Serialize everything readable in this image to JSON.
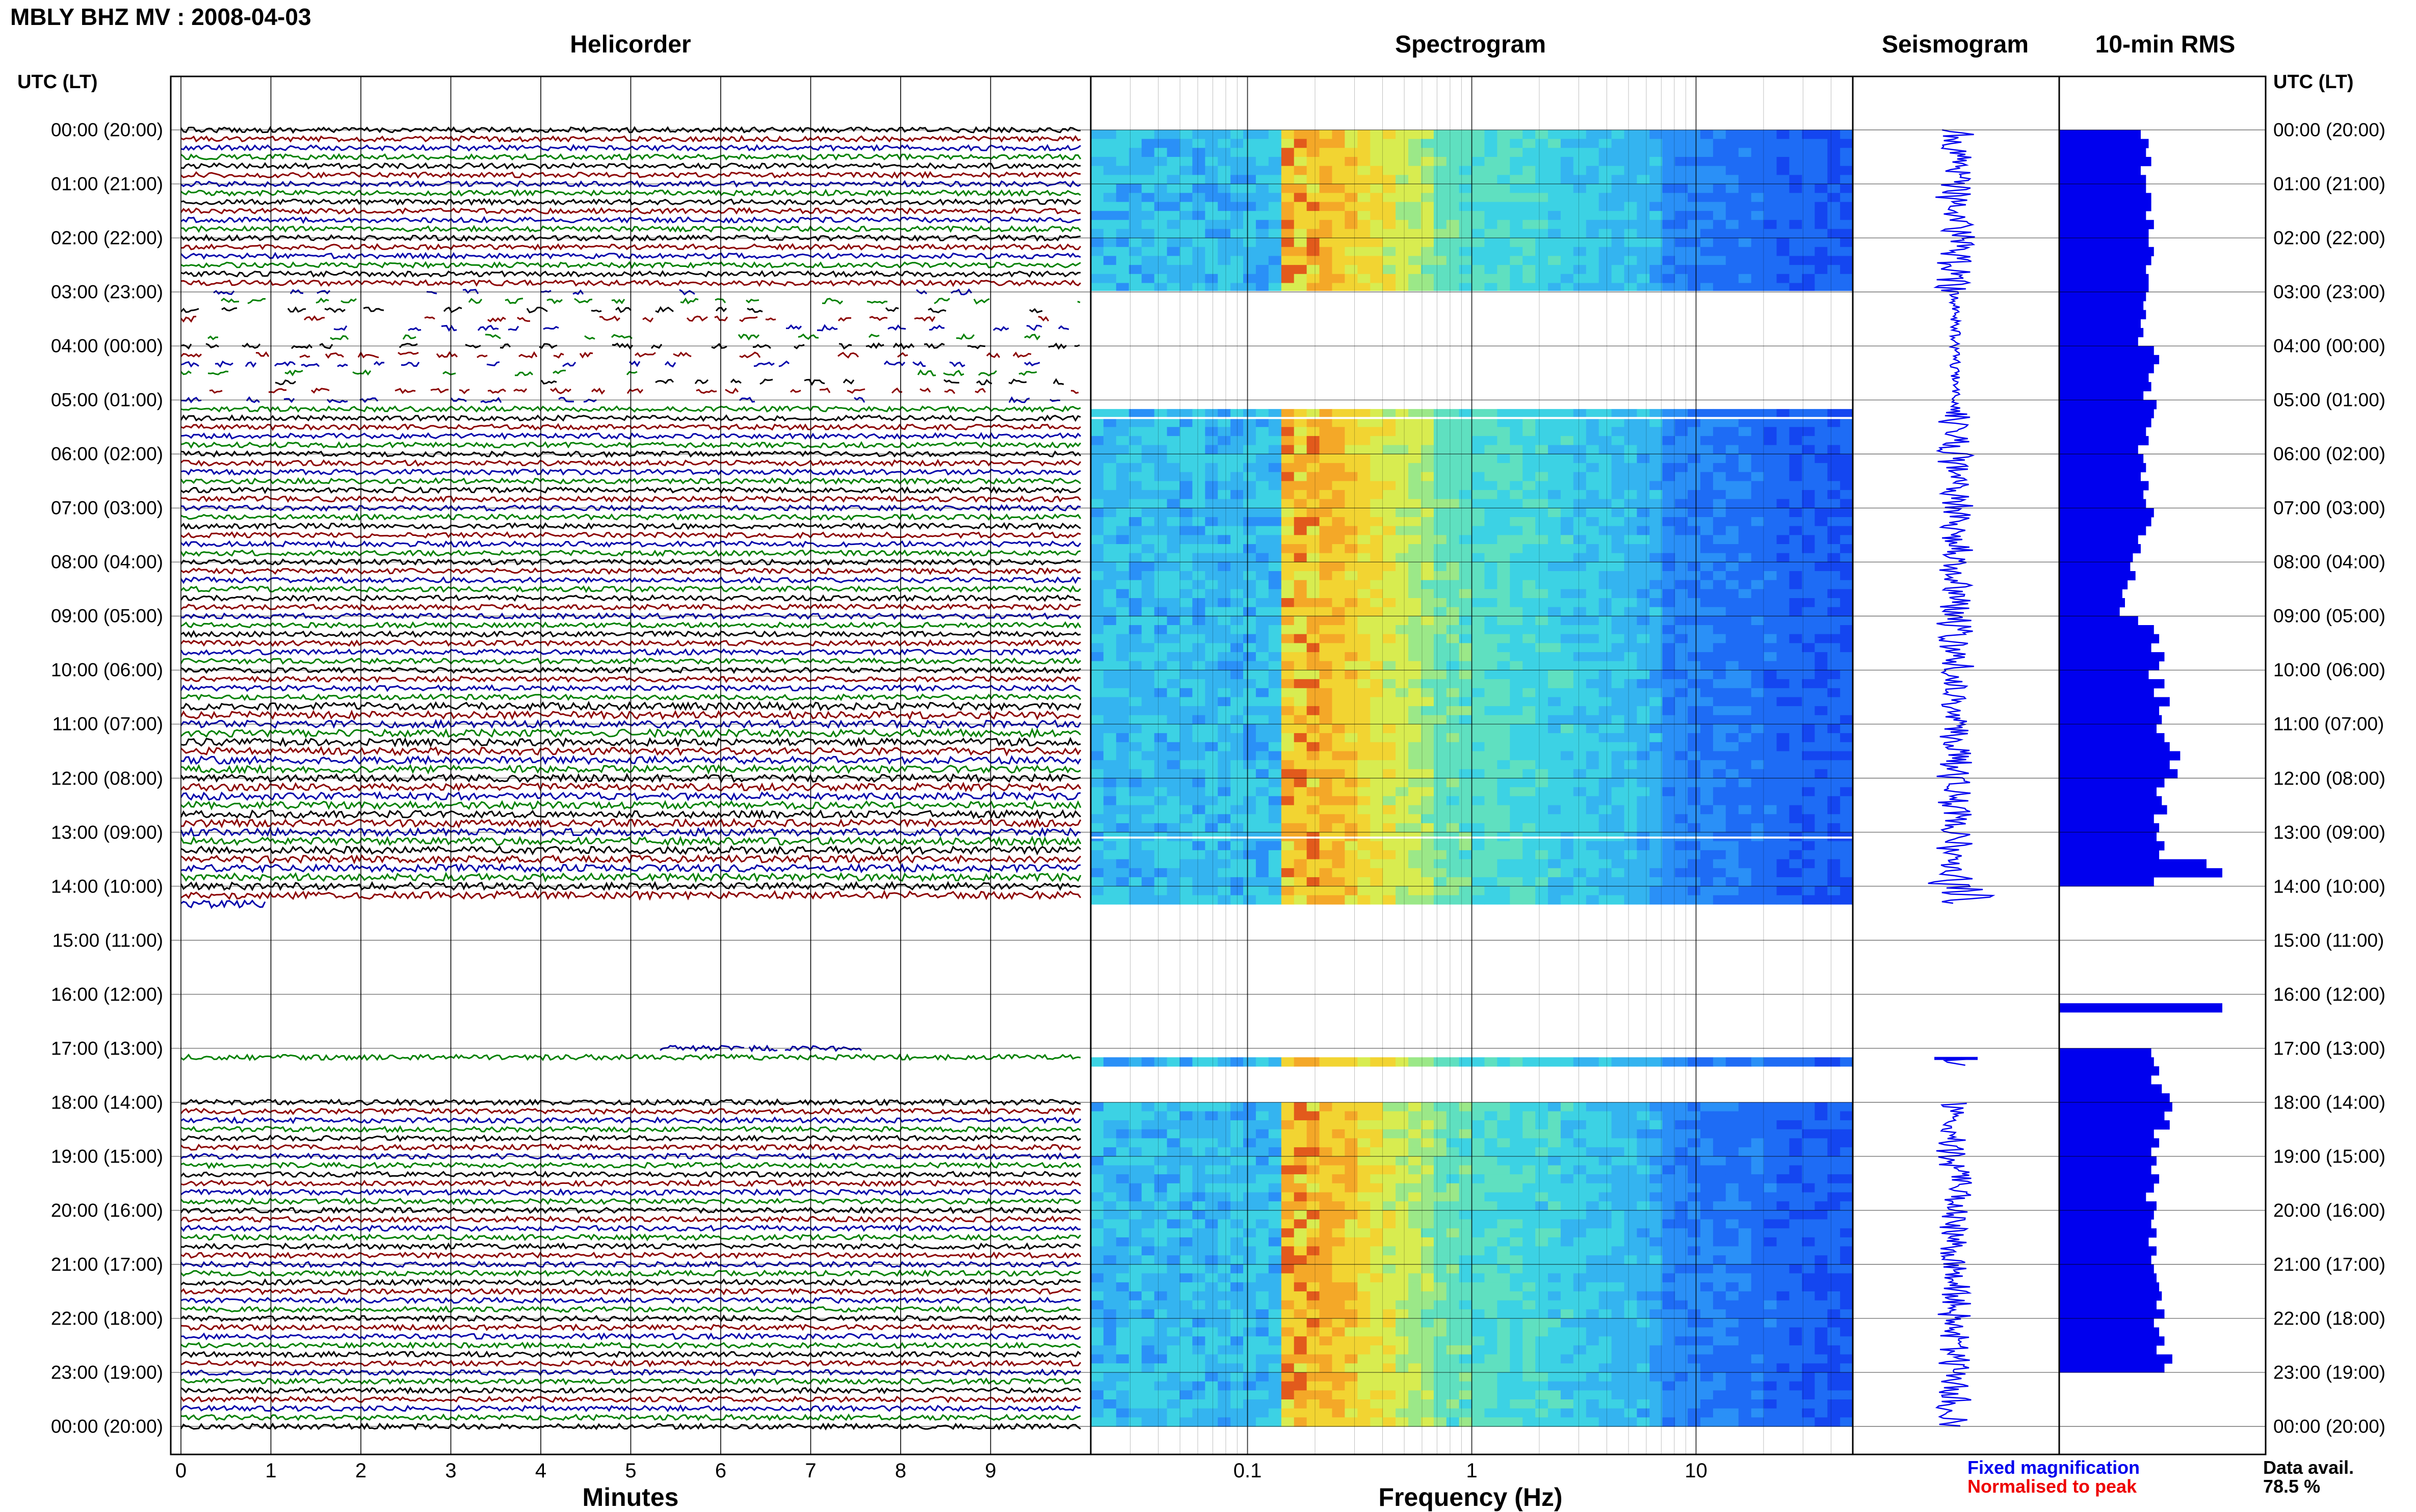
{
  "title": "MBLY BHZ MV : 2008-04-03",
  "panels": {
    "helicorder": "Helicorder",
    "spectrogram": "Spectrogram",
    "seismogram": "Seismogram",
    "rms": "10-min RMS"
  },
  "time_axis_label": "UTC (LT)",
  "time_labels": [
    "00:00 (20:00)",
    "01:00 (21:00)",
    "02:00 (22:00)",
    "03:00 (23:00)",
    "04:00 (00:00)",
    "05:00 (01:00)",
    "06:00 (02:00)",
    "07:00 (03:00)",
    "08:00 (04:00)",
    "09:00 (05:00)",
    "10:00 (06:00)",
    "11:00 (07:00)",
    "12:00 (08:00)",
    "13:00 (09:00)",
    "14:00 (10:00)",
    "15:00 (11:00)",
    "16:00 (12:00)",
    "17:00 (13:00)",
    "18:00 (14:00)",
    "19:00 (15:00)",
    "20:00 (16:00)",
    "21:00 (17:00)",
    "22:00 (18:00)",
    "23:00 (19:00)",
    "00:00 (20:00)"
  ],
  "helicorder_axis": {
    "label": "Minutes",
    "ticks": [
      "0",
      "1",
      "2",
      "3",
      "4",
      "5",
      "6",
      "7",
      "8",
      "9"
    ]
  },
  "spectrogram_axis": {
    "label": "Frequency (Hz)",
    "ticks": [
      "0.1",
      "1",
      "10"
    ]
  },
  "legend": {
    "fixed": "Fixed magnification",
    "normalised": "Normalised to peak",
    "fixed_color": "#0000ee",
    "normalised_color": "#ee0000"
  },
  "data_availability": {
    "label": "Data avail.",
    "value": "78.5 %"
  },
  "colors": {
    "trace_black": "#000000",
    "trace_red": "#8b0000",
    "trace_blue": "#0000aa",
    "trace_green": "#008000",
    "rms_bar": "#0000ee",
    "seis": "#0000ee"
  },
  "data_gaps_utc": [
    [
      "03:00",
      "05:10"
    ],
    [
      "14:20",
      "17:10"
    ],
    [
      "17:20",
      "18:00"
    ]
  ],
  "rms_10min": [
    0.62,
    0.68,
    0.66,
    0.7,
    0.62,
    0.66,
    0.66,
    0.7,
    0.7,
    0.66,
    0.72,
    0.68,
    0.68,
    0.72,
    0.7,
    0.66,
    0.68,
    0.68,
    0.66,
    0.64,
    0.66,
    0.62,
    0.64,
    0.6,
    0.72,
    0.76,
    0.72,
    0.68,
    0.7,
    0.64,
    0.74,
    0.72,
    0.7,
    0.66,
    0.68,
    0.6,
    0.64,
    0.66,
    0.62,
    0.68,
    0.64,
    0.66,
    0.72,
    0.7,
    0.66,
    0.6,
    0.62,
    0.56,
    0.54,
    0.58,
    0.52,
    0.48,
    0.5,
    0.46,
    0.6,
    0.72,
    0.76,
    0.7,
    0.8,
    0.76,
    0.68,
    0.8,
    0.72,
    0.84,
    0.76,
    0.78,
    0.74,
    0.8,
    0.84,
    0.92,
    0.84,
    0.9,
    0.8,
    0.74,
    0.78,
    0.82,
    0.72,
    0.76,
    0.74,
    0.8,
    0.76,
    1.12,
    1.24,
    0.72,
    0,
    0,
    0,
    0,
    0,
    0,
    0,
    0,
    0,
    0,
    0,
    0,
    0,
    1.24,
    0,
    0,
    0,
    0,
    0.7,
    0.72,
    0.76,
    0.7,
    0.78,
    0.84,
    0.86,
    0.8,
    0.84,
    0.72,
    0.76,
    0.7,
    0.74,
    0.7,
    0.76,
    0.72,
    0.66,
    0.74,
    0.72,
    0.7,
    0.74,
    0.68,
    0.74,
    0.7,
    0.72,
    0.74,
    0.76,
    0.78,
    0.74,
    0.8,
    0.72,
    0.76,
    0.8,
    0.74,
    0.86,
    0.8
  ]
}
